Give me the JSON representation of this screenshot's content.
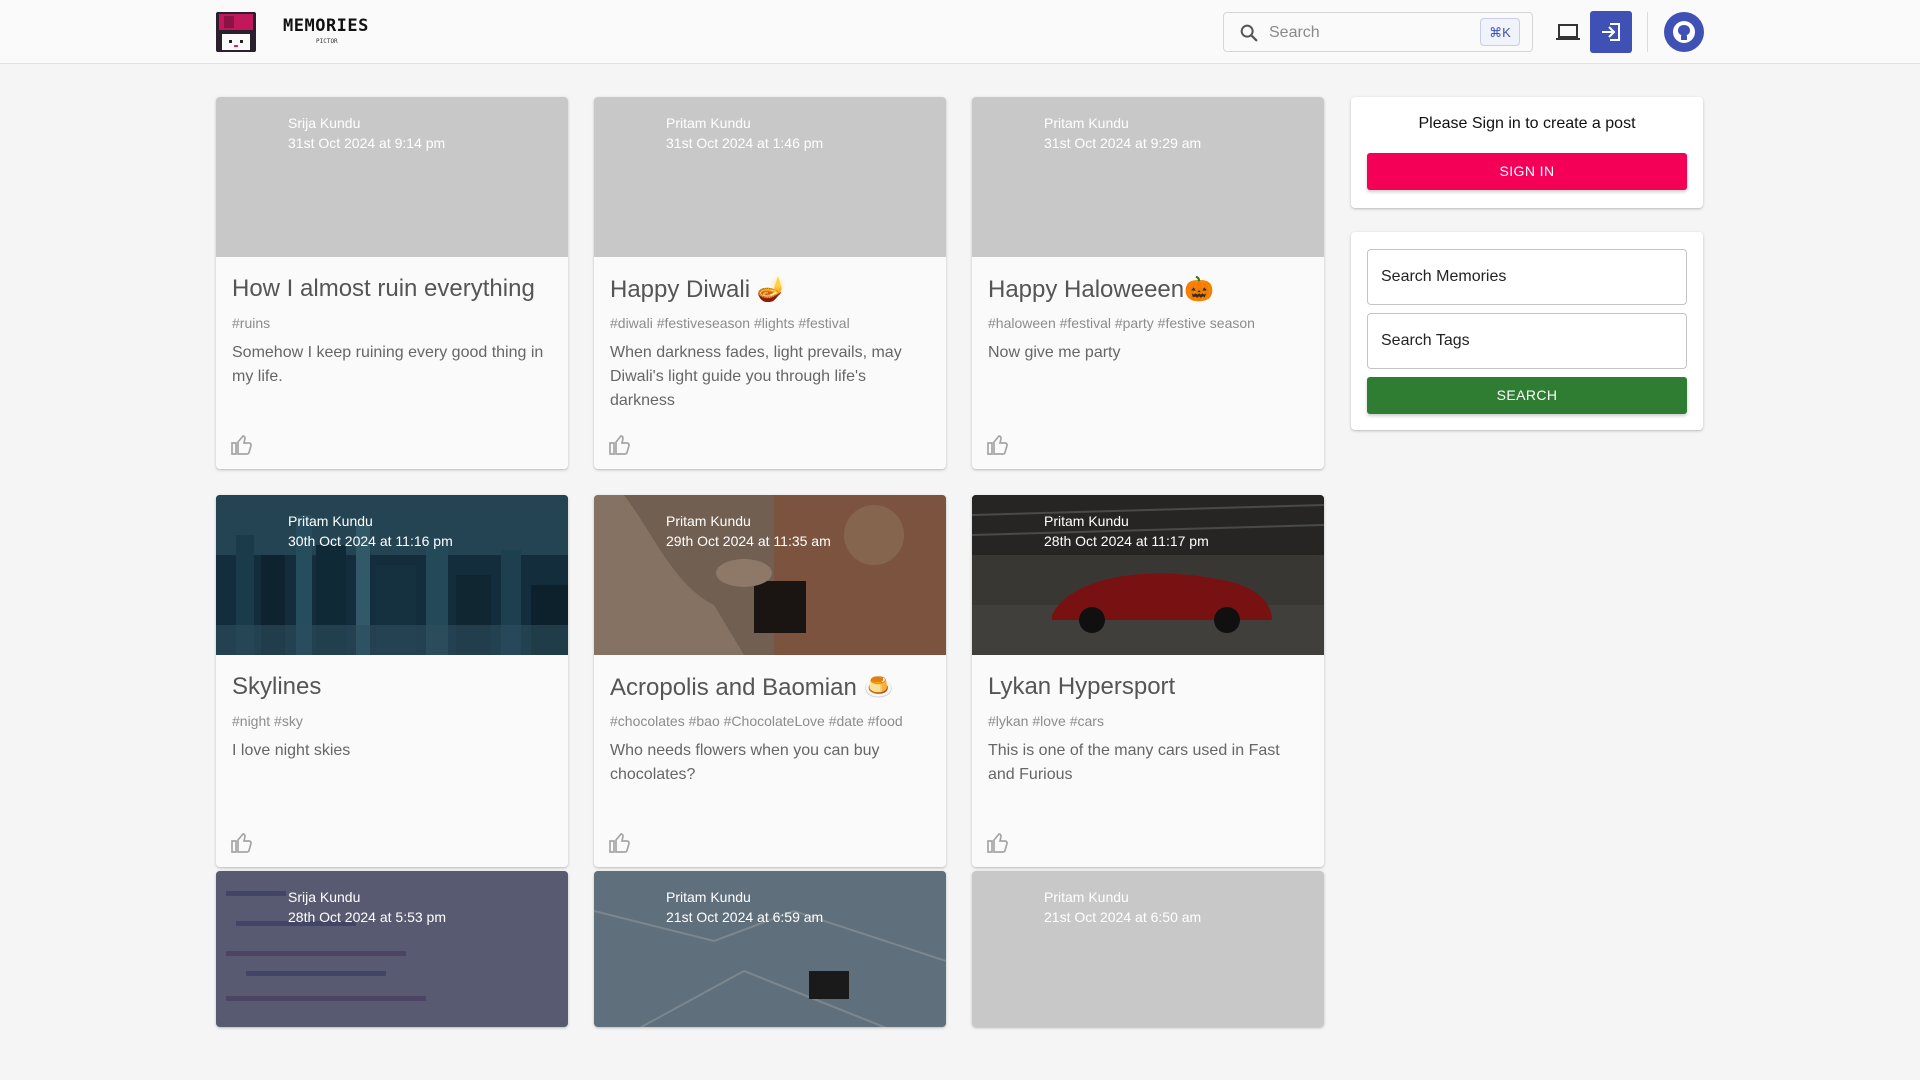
{
  "header": {
    "brand": "MEMORIES",
    "brand_sub": "PICTOR",
    "search_placeholder": "Search",
    "search_shortcut": "⌘K"
  },
  "posts": [
    {
      "author": "Srija Kundu",
      "date": "31st Oct 2024 at 9:14 pm",
      "title": "How I almost ruin everything",
      "tags": "#ruins",
      "message": "Somehow I keep ruining every good thing in my life."
    },
    {
      "author": "Pritam Kundu",
      "date": "31st Oct 2024 at 1:46 pm",
      "title": "Happy Diwali 🪔",
      "tags": "#diwali #festiveseason #lights #festival",
      "message": "When darkness fades, light prevails, may Diwali's light guide you through life's darkness"
    },
    {
      "author": "Pritam Kundu",
      "date": "31st Oct 2024 at 9:29 am",
      "title": "Happy Haloweeen🎃",
      "tags": "#haloween #festival #party #festive season",
      "message": "Now give me party"
    },
    {
      "author": "Pritam Kundu",
      "date": "30th Oct 2024 at 11:16 pm",
      "title": "Skylines",
      "tags": "#night #sky",
      "message": "I love night skies"
    },
    {
      "author": "Pritam Kundu",
      "date": "29th Oct 2024 at 11:35 am",
      "title": "Acropolis and Baomian 🍮",
      "tags": "#chocolates #bao #ChocolateLove #date #food",
      "message": "Who needs flowers when you can buy chocolates?"
    },
    {
      "author": "Pritam Kundu",
      "date": "28th Oct 2024 at 11:17 pm",
      "title": "Lykan Hypersport",
      "tags": "#lykan #love #cars",
      "message": "This is one of the many cars used in Fast and Furious"
    },
    {
      "author": "Srija Kundu",
      "date": "28th Oct 2024 at 5:53 pm"
    },
    {
      "author": "Pritam Kundu",
      "date": "21st Oct 2024 at 6:59 am"
    },
    {
      "author": "Pritam Kundu",
      "date": "21st Oct 2024 at 6:50 am"
    }
  ],
  "sidebar": {
    "signin_prompt": "Please Sign in to create a post",
    "signin_button": "SIGN IN",
    "search_memories": "Search Memories",
    "search_tags": "Search Tags",
    "search_button": "SEARCH"
  },
  "colors": {
    "primary": "#3f51b5",
    "secondary": "#f50057",
    "success": "#2e7d32"
  },
  "icons": [
    "search-icon",
    "laptop-icon",
    "login-icon",
    "github-icon",
    "thumb-up-icon",
    "floppy-logo-icon"
  ]
}
